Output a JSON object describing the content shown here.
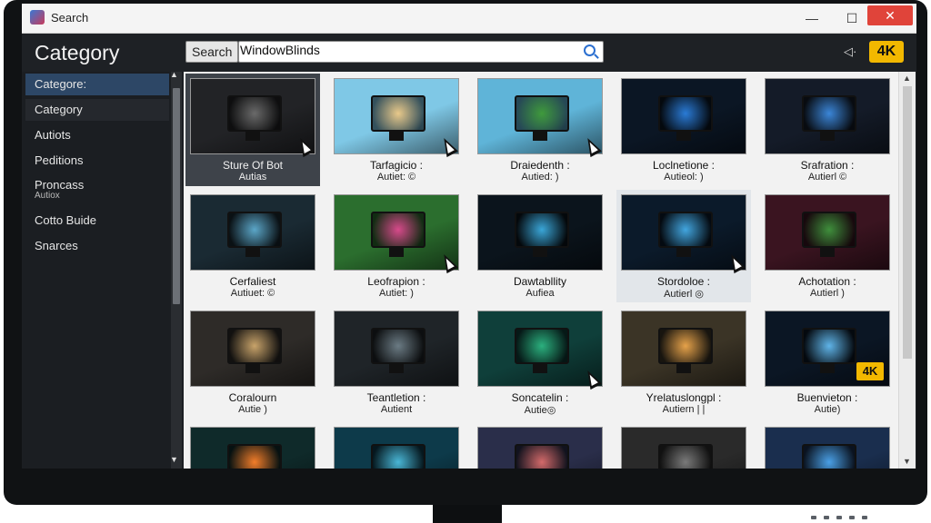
{
  "window": {
    "title": "Search",
    "minimize": "—",
    "maximize": "☐",
    "close": "✕"
  },
  "header": {
    "category_title": "Category",
    "search_label": "Search",
    "search_value": "WindowBlinds",
    "badge": "4K"
  },
  "sidebar": {
    "items": [
      {
        "label": "Categore:"
      },
      {
        "label": "Category"
      },
      {
        "label": "Autiots"
      },
      {
        "label": "Peditions"
      },
      {
        "label": "Proncass"
      },
      {
        "label": "Cotto Buide"
      },
      {
        "label": "Snarces"
      }
    ],
    "sub_label": "Autiox",
    "scroll_up": "▲",
    "scroll_down": "▼"
  },
  "gallery": {
    "cards": [
      {
        "title": "Sture Of Bot",
        "author": "Autias",
        "bg": "#222326",
        "accent": "#6a6a6a"
      },
      {
        "title": "Tarfagicio :",
        "author": "Autiet: ©",
        "bg": "#7fc8e6",
        "accent": "#e9c98a"
      },
      {
        "title": "Draiedenth :",
        "author": "Autied: )",
        "bg": "#5fb4d8",
        "accent": "#3f9a3c"
      },
      {
        "title": "Loclnetione :",
        "author": "Autieol: )",
        "bg": "#0b1624",
        "accent": "#2a7bd6"
      },
      {
        "title": "Srafration :",
        "author": "Autierl ©",
        "bg": "#141b28",
        "accent": "#3b86d8"
      },
      {
        "title": "Cerfaliest",
        "author": "Autiuet: ©",
        "bg": "#1a2a33",
        "accent": "#5ba6c8"
      },
      {
        "title": "Leofrapion :",
        "author": "Autiet: )",
        "bg": "#2b6e2e",
        "accent": "#d74a8b"
      },
      {
        "title": "Dawtabllity",
        "author": "Aufiea",
        "bg": "#0b141c",
        "accent": "#3aa6d8"
      },
      {
        "title": "Stordoloe :",
        "author": "Autierl ◎",
        "bg": "#0b1a2a",
        "accent": "#42a6e0"
      },
      {
        "title": "Achotation :",
        "author": "Autierl )",
        "bg": "#3a1420",
        "accent": "#3f8f3c"
      },
      {
        "title": "Coralourn",
        "author": "Autie )",
        "bg": "#2e2b28",
        "accent": "#c8a36a"
      },
      {
        "title": "Teantletion :",
        "author": "Autient",
        "bg": "#1f2428",
        "accent": "#6b7b84"
      },
      {
        "title": "Soncatelin :",
        "author": "Autie◎",
        "bg": "#0f3f3a",
        "accent": "#2bb07e"
      },
      {
        "title": "Yrelatuslongpl :",
        "author": "Autiern | |",
        "bg": "#3b3426",
        "accent": "#e6a24a"
      },
      {
        "title": "Buenvieton :",
        "author": "Autie)",
        "bg": "#0b1624",
        "accent": "#5fb4e8"
      },
      {
        "title": "",
        "author": "",
        "bg": "#0f2a2a",
        "accent": "#f27d2a"
      },
      {
        "title": "",
        "author": "",
        "bg": "#0d3a4a",
        "accent": "#49b6d6"
      },
      {
        "title": "",
        "author": "",
        "bg": "#2a2e4a",
        "accent": "#d36a6a"
      },
      {
        "title": "",
        "author": "",
        "bg": "#2a2a2a",
        "accent": "#7a7a7a"
      },
      {
        "title": "",
        "author": "",
        "bg": "#1a2e4e",
        "accent": "#4aa0e6"
      }
    ],
    "corner_badge": "4K"
  },
  "scrollbar": {
    "up": "▲",
    "down": "▼"
  }
}
